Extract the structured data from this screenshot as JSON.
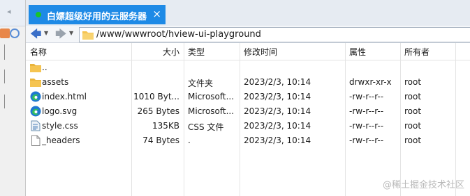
{
  "window": {
    "tab_title": "白嫖超级好用的云服务器",
    "tab_close": "×",
    "tab_status_color": "#18c42a"
  },
  "address": {
    "path": "/www/wwwroot/hview-ui-playground"
  },
  "columns": {
    "name": "名称",
    "size": "大小",
    "type": "类型",
    "modified": "修改时间",
    "attributes": "属性",
    "owner": "所有者"
  },
  "files": [
    {
      "name": "..",
      "size": "",
      "type": "",
      "modified": "",
      "attributes": "",
      "owner": "",
      "icon": "folder-icon"
    },
    {
      "name": "assets",
      "size": "",
      "type": "文件夹",
      "modified": "2023/2/3, 10:14",
      "attributes": "drwxr-xr-x",
      "owner": "root",
      "icon": "folder-icon"
    },
    {
      "name": "index.html",
      "size": "1010 Byt...",
      "type": "Microsoft...",
      "modified": "2023/2/3, 10:14",
      "attributes": "-rw-r--r--",
      "owner": "root",
      "icon": "edge-icon"
    },
    {
      "name": "logo.svg",
      "size": "265 Bytes",
      "type": "Microsoft...",
      "modified": "2023/2/3, 10:14",
      "attributes": "-rw-r--r--",
      "owner": "root",
      "icon": "edge-icon"
    },
    {
      "name": "style.css",
      "size": "135KB",
      "type": "CSS 文件",
      "modified": "2023/2/3, 10:14",
      "attributes": "-rw-r--r--",
      "owner": "root",
      "icon": "css-file-icon"
    },
    {
      "name": "_headers",
      "size": "74 Bytes",
      "type": ".",
      "modified": "2023/2/3, 10:14",
      "attributes": "-rw-r--r--",
      "owner": "root",
      "icon": "blank-file-icon"
    }
  ],
  "watermark": "@稀土掘金技术社区",
  "colors": {
    "tab_active": "#1e8ae6",
    "folder": "#f5c451",
    "edge_blue": "#1f78d1",
    "edge_green": "#35c15d"
  }
}
